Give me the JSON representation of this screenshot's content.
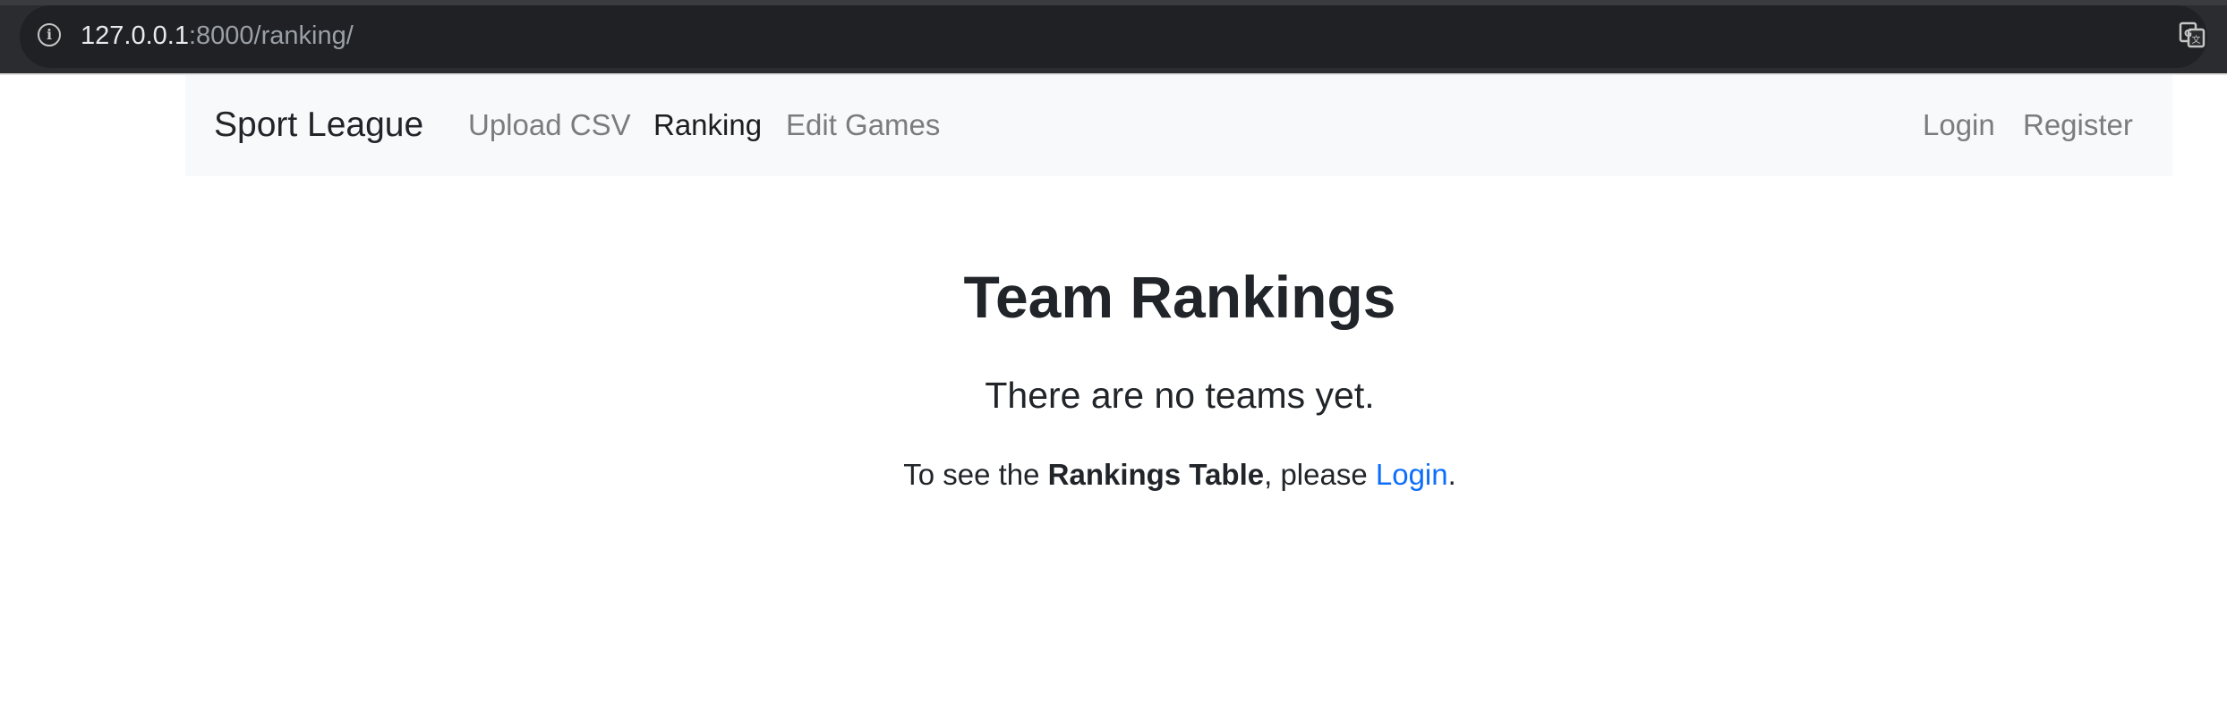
{
  "browser": {
    "url_host": "127.0.0.1",
    "url_path": ":8000/ranking/"
  },
  "navbar": {
    "brand": "Sport League",
    "links": [
      {
        "label": "Upload CSV"
      },
      {
        "label": "Ranking"
      },
      {
        "label": "Edit Games"
      }
    ],
    "right_links": [
      {
        "label": "Login"
      },
      {
        "label": "Register"
      }
    ]
  },
  "main": {
    "title": "Team Rankings",
    "empty_message": "There are no teams yet.",
    "login_prompt": {
      "prefix": "To see the ",
      "emphasis": "Rankings Table",
      "middle": ", please ",
      "link": "Login",
      "suffix": "."
    }
  },
  "colors": {
    "accent": "#0d6efd",
    "navbar_bg": "#f8f9fa",
    "text": "#212529",
    "nav_muted": "#7a7d80"
  }
}
